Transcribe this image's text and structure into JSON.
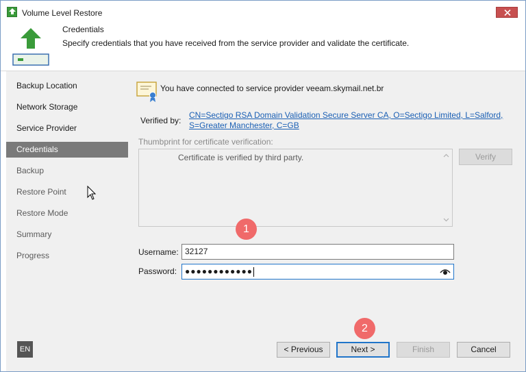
{
  "window": {
    "title": "Volume Level Restore"
  },
  "header": {
    "title": "Credentials",
    "description": "Specify credentials that you have received from the service provider and validate the certificate."
  },
  "sidebar": {
    "items": [
      {
        "label": "Backup Location",
        "state": "done"
      },
      {
        "label": "Network Storage",
        "state": "done"
      },
      {
        "label": "Service Provider",
        "state": "done"
      },
      {
        "label": "Credentials",
        "state": "active"
      },
      {
        "label": "Backup",
        "state": "pending"
      },
      {
        "label": "Restore Point",
        "state": "pending"
      },
      {
        "label": "Restore Mode",
        "state": "pending"
      },
      {
        "label": "Summary",
        "state": "pending"
      },
      {
        "label": "Progress",
        "state": "pending"
      }
    ]
  },
  "main": {
    "connected_text": "You have connected to service provider veeam.skymail.net.br",
    "verified_label": "Verified by:",
    "verified_link_line1": "CN=Sectigo RSA Domain Validation Secure Server CA, O=Sectigo Limited, L=Salford,",
    "verified_link_line2": "S=Greater Manchester, C=GB",
    "thumbprint_label": "Thumbprint for certificate verification:",
    "thumbprint_text": "Certificate is verified by third party.",
    "verify_button": "Verify",
    "username_label": "Username:",
    "username_value": "32127",
    "password_label": "Password:",
    "password_value": "●●●●●●●●●●●●"
  },
  "annotations": {
    "badge1": "1",
    "badge2": "2"
  },
  "footer": {
    "language": "EN",
    "previous_button": "< Previous",
    "next_button": "Next >",
    "finish_button": "Finish",
    "cancel_button": "Cancel"
  },
  "colors": {
    "accent_blue": "#1f74c9",
    "link_blue": "#1a5fb4",
    "active_nav": "#7a7a7a",
    "badge_red": "#f06a6a",
    "close_red": "#c75050",
    "brand_green": "#3a9b3a"
  }
}
